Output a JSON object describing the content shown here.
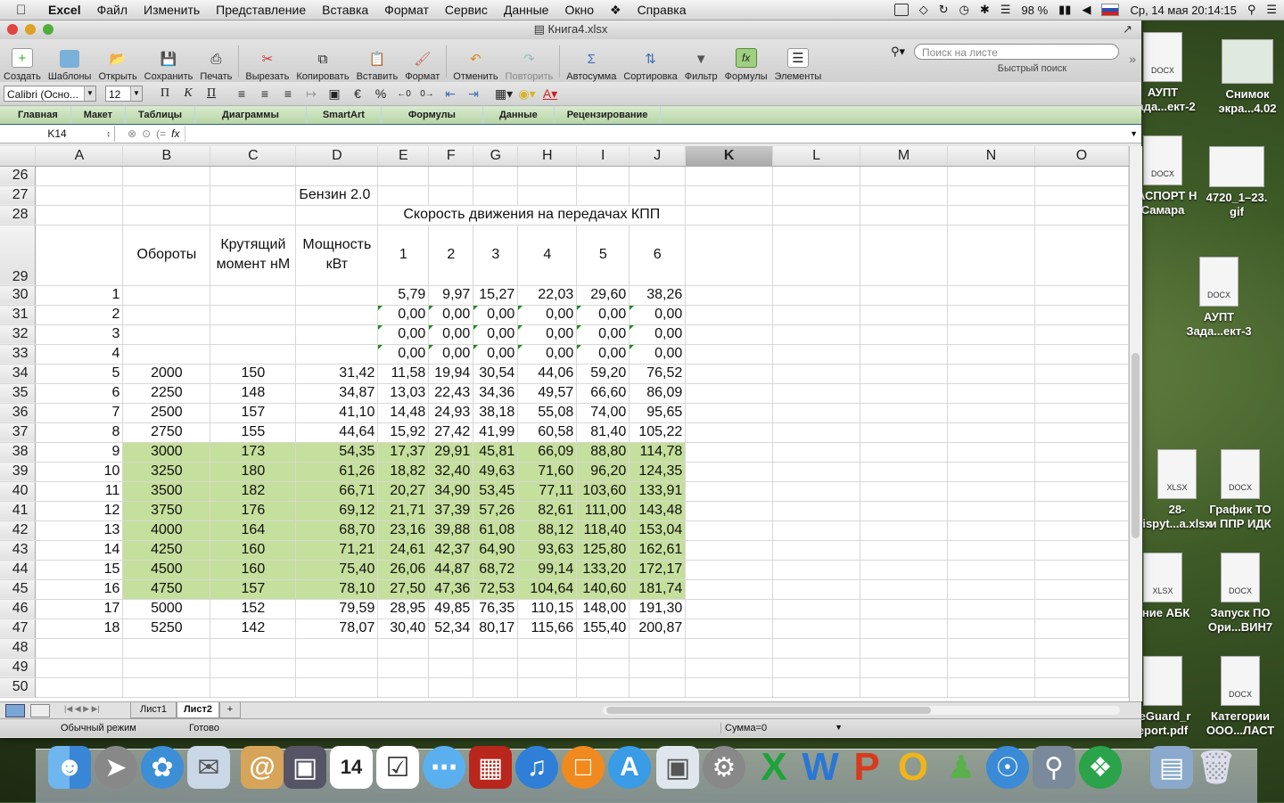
{
  "menubar": {
    "app": "Excel",
    "items": [
      "Файл",
      "Изменить",
      "Представление",
      "Вставка",
      "Формат",
      "Сервис",
      "Данные",
      "Окно",
      "Справка"
    ],
    "battery": "98 %",
    "datetime": "Ср, 14 мая  20:14:15"
  },
  "window": {
    "title": "Книга4.xlsx"
  },
  "toolbar": {
    "buttons": [
      "Создать",
      "Шаблоны",
      "Открыть",
      "Сохранить",
      "Печать",
      "Вырезать",
      "Копировать",
      "Вставить",
      "Формат",
      "Отменить",
      "Повторить",
      "Автосумма",
      "Сортировка",
      "Фильтр",
      "Формулы",
      "Элементы"
    ],
    "search_placeholder": "Поиск на листе",
    "search_label": "Быстрый поиск"
  },
  "format": {
    "font": "Calibri (Осно...",
    "size": "12"
  },
  "ribbon": [
    "Главная",
    "Макет",
    "Таблицы",
    "Диаграммы",
    "SmartArt",
    "Формулы",
    "Данные",
    "Рецензирование"
  ],
  "formula": {
    "cell": "K14",
    "fx": "fx"
  },
  "columns": [
    "A",
    "B",
    "C",
    "D",
    "E",
    "F",
    "G",
    "H",
    "I",
    "J",
    "K",
    "L",
    "M",
    "N",
    "O"
  ],
  "sheet": {
    "title_cell": "Бензин 2.0",
    "speed_header": "Скорость движения на передачах КПП",
    "h_rpm": "Обороты",
    "h_torque": "Крутящий момент нМ",
    "h_power": "Мощность кВт",
    "gears": [
      "1",
      "2",
      "3",
      "4",
      "5",
      "6"
    ],
    "rows": [
      {
        "r": "30",
        "a": "1",
        "b": "",
        "c": "",
        "d": "",
        "v": [
          "5,79",
          "9,97",
          "15,27",
          "22,03",
          "29,60",
          "38,26"
        ]
      },
      {
        "r": "31",
        "a": "2",
        "b": "",
        "c": "",
        "d": "",
        "v": [
          "0,00",
          "0,00",
          "0,00",
          "0,00",
          "0,00",
          "0,00"
        ]
      },
      {
        "r": "32",
        "a": "3",
        "b": "",
        "c": "",
        "d": "",
        "v": [
          "0,00",
          "0,00",
          "0,00",
          "0,00",
          "0,00",
          "0,00"
        ]
      },
      {
        "r": "33",
        "a": "4",
        "b": "",
        "c": "",
        "d": "",
        "v": [
          "0,00",
          "0,00",
          "0,00",
          "0,00",
          "0,00",
          "0,00"
        ]
      },
      {
        "r": "34",
        "a": "5",
        "b": "2000",
        "c": "150",
        "d": "31,42",
        "v": [
          "11,58",
          "19,94",
          "30,54",
          "44,06",
          "59,20",
          "76,52"
        ]
      },
      {
        "r": "35",
        "a": "6",
        "b": "2250",
        "c": "148",
        "d": "34,87",
        "v": [
          "13,03",
          "22,43",
          "34,36",
          "49,57",
          "66,60",
          "86,09"
        ]
      },
      {
        "r": "36",
        "a": "7",
        "b": "2500",
        "c": "157",
        "d": "41,10",
        "v": [
          "14,48",
          "24,93",
          "38,18",
          "55,08",
          "74,00",
          "95,65"
        ]
      },
      {
        "r": "37",
        "a": "8",
        "b": "2750",
        "c": "155",
        "d": "44,64",
        "v": [
          "15,92",
          "27,42",
          "41,99",
          "60,58",
          "81,40",
          "105,22"
        ]
      },
      {
        "r": "38",
        "a": "9",
        "b": "3000",
        "c": "173",
        "d": "54,35",
        "v": [
          "17,37",
          "29,91",
          "45,81",
          "66,09",
          "88,80",
          "114,78"
        ]
      },
      {
        "r": "39",
        "a": "10",
        "b": "3250",
        "c": "180",
        "d": "61,26",
        "v": [
          "18,82",
          "32,40",
          "49,63",
          "71,60",
          "96,20",
          "124,35"
        ]
      },
      {
        "r": "40",
        "a": "11",
        "b": "3500",
        "c": "182",
        "d": "66,71",
        "v": [
          "20,27",
          "34,90",
          "53,45",
          "77,11",
          "103,60",
          "133,91"
        ]
      },
      {
        "r": "41",
        "a": "12",
        "b": "3750",
        "c": "176",
        "d": "69,12",
        "v": [
          "21,71",
          "37,39",
          "57,26",
          "82,61",
          "111,00",
          "143,48"
        ]
      },
      {
        "r": "42",
        "a": "13",
        "b": "4000",
        "c": "164",
        "d": "68,70",
        "v": [
          "23,16",
          "39,88",
          "61,08",
          "88,12",
          "118,40",
          "153,04"
        ]
      },
      {
        "r": "43",
        "a": "14",
        "b": "4250",
        "c": "160",
        "d": "71,21",
        "v": [
          "24,61",
          "42,37",
          "64,90",
          "93,63",
          "125,80",
          "162,61"
        ]
      },
      {
        "r": "44",
        "a": "15",
        "b": "4500",
        "c": "160",
        "d": "75,40",
        "v": [
          "26,06",
          "44,87",
          "68,72",
          "99,14",
          "133,20",
          "172,17"
        ]
      },
      {
        "r": "45",
        "a": "16",
        "b": "4750",
        "c": "157",
        "d": "78,10",
        "v": [
          "27,50",
          "47,36",
          "72,53",
          "104,64",
          "140,60",
          "181,74"
        ]
      },
      {
        "r": "46",
        "a": "17",
        "b": "5000",
        "c": "152",
        "d": "79,59",
        "v": [
          "28,95",
          "49,85",
          "76,35",
          "110,15",
          "148,00",
          "191,30"
        ]
      },
      {
        "r": "47",
        "a": "18",
        "b": "5250",
        "c": "142",
        "d": "78,07",
        "v": [
          "30,40",
          "52,34",
          "80,17",
          "115,66",
          "155,40",
          "200,87"
        ]
      }
    ],
    "highlight_color": "#c5df9c"
  },
  "tabs": [
    "Лист1",
    "Лист2"
  ],
  "status": {
    "mode": "Обычный режим",
    "ready": "Готово",
    "sum": "Сумма=0"
  },
  "desktop": [
    {
      "label": "АУПТ Зада...ект-2",
      "type": "DOCX"
    },
    {
      "label": "Снимок экра...4.02",
      "type": ""
    },
    {
      "label": "ПАСПОРТ Н Самара",
      "type": "DOCX"
    },
    {
      "label": "4720_1–23. gif",
      "type": ""
    },
    {
      "label": "АУПТ Зада...ект-3",
      "type": "DOCX"
    },
    {
      "label": "28- ispyt...a.xlsx",
      "type": "XLSX"
    },
    {
      "label": "График ТО и ППР ИДК",
      "type": "DOCX"
    },
    {
      "label": "ание АБК",
      "type": "XLSX"
    },
    {
      "label": "Запуск ПО Ори...ВИН7",
      "type": "DOCX"
    },
    {
      "label": "reGuard_r eport.pdf",
      "type": ""
    },
    {
      "label": "Категории ООО...ЛАСТ",
      "type": "DOCX"
    }
  ]
}
